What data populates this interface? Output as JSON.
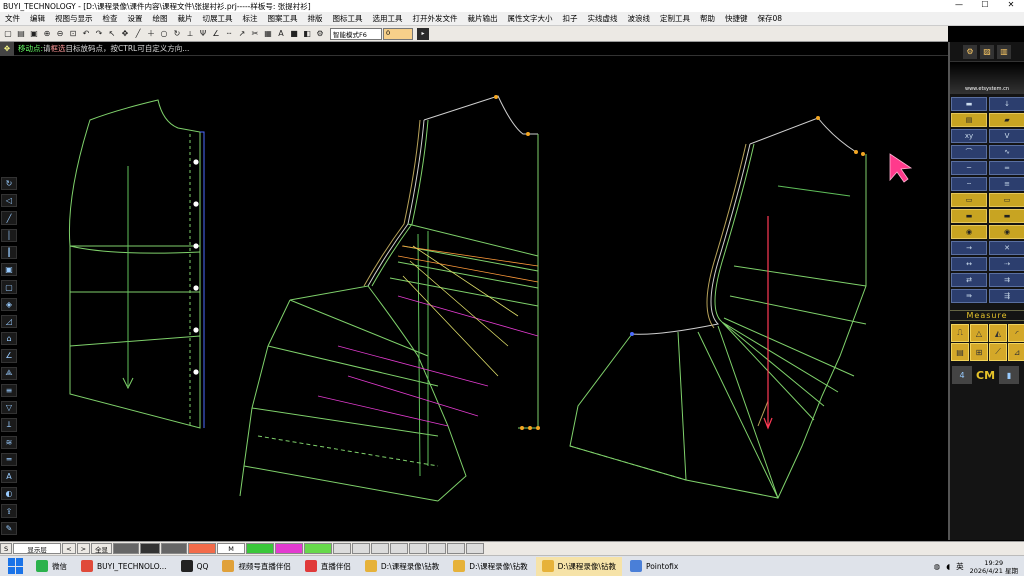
{
  "window": {
    "title": "BUYI_TECHNOLOGY - [D:\\课程录像\\课件内容\\课程文件\\张提衬衫.prj-----样板号: 张提衬衫]"
  },
  "menu": [
    "文件",
    "编辑",
    "视图与显示",
    "检查",
    "设置",
    "绘图",
    "裁片",
    "切展工具",
    "标注",
    "图案工具",
    "排版",
    "图标工具",
    "选用工具",
    "打开外发文件",
    "裁片输出",
    "属性文字大小",
    "扣子",
    "实线虚线",
    "波浪线",
    "定制工具",
    "帮助",
    "快捷键",
    "保存08"
  ],
  "toolbar": {
    "mode_select": "智能模式F6",
    "zero_value": "0"
  },
  "status": {
    "icon": "move-icon",
    "label": "移动点:",
    "text_before": "请",
    "highlight": "框选",
    "text_after": "目标放码点，按CTRL可自定义方向..."
  },
  "right_panel": {
    "brand_text": "www.etsystem.cn",
    "measure_label": "Measure",
    "unit_label": "CM",
    "unit_number": "4"
  },
  "bottom_status": {
    "layer": "显示层",
    "code": "M",
    "buttons": [
      "<",
      ">",
      "全显"
    ]
  },
  "taskbar": {
    "items": [
      {
        "label": "微信",
        "color": "#2bb24c"
      },
      {
        "label": "BUYI_TECHNOLO...",
        "color": "#e04a3a"
      },
      {
        "label": "QQ",
        "color": "#222"
      },
      {
        "label": "视频号直播伴侣",
        "color": "#e0a13a"
      },
      {
        "label": "直播伴侣",
        "color": "#e03a3a"
      },
      {
        "label": "D:\\课程录像\\钻教",
        "color": "#e6b23a"
      },
      {
        "label": "D:\\课程录像\\钻教",
        "color": "#e6b23a"
      },
      {
        "label": "D:\\课程录像\\钻教",
        "color": "#e6b23a"
      },
      {
        "label": "Pointofix",
        "color": "#4a7fd8"
      }
    ],
    "active_index": 7,
    "ime": "英",
    "time": "19:29",
    "date": "2026/4/21 星期"
  },
  "colors": {
    "pattern_line": "#7fd16b",
    "highlight_pink": "#e33bd0",
    "cursor": "#ff3a8c",
    "accent_yellow": "#e5c22a"
  }
}
